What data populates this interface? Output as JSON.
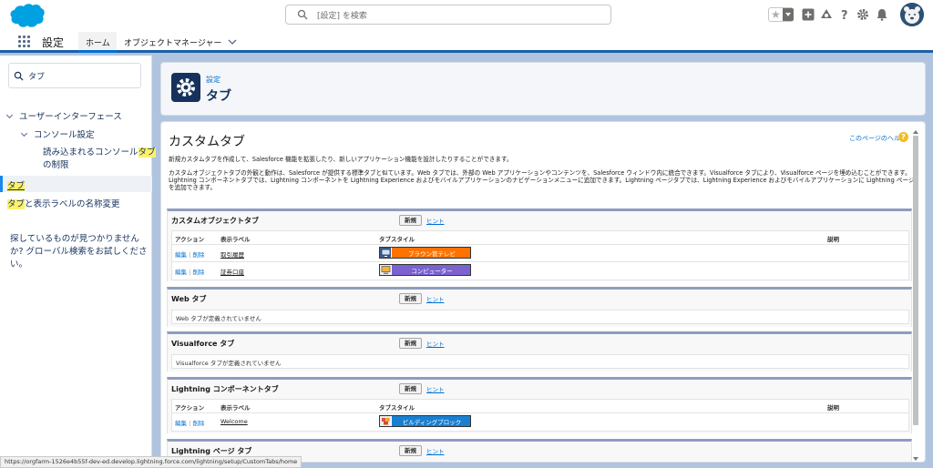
{
  "header": {
    "search_placeholder": "[設定] を検索"
  },
  "nav": {
    "app_name": "設定",
    "tabs": [
      {
        "label": "ホーム"
      },
      {
        "label": "オブジェクトマネージャー"
      }
    ]
  },
  "sidebar": {
    "quick_find_value": "タブ",
    "tree": {
      "user_interface": "ユーザーインターフェース",
      "console_settings": "コンソール設定",
      "console_tab_limit_pre": "読み込まれるコンソール",
      "console_tab_limit_hl": "タブ",
      "console_tab_limit_post": "の制限",
      "tabs_hl": "タブ",
      "rename_hl": "タブ",
      "rename_post": "と表示ラベルの名称変更"
    },
    "not_found_text": "探しているものが見つかりませんか? グローバル検索をお試しください。"
  },
  "page_header": {
    "eyebrow": "設定",
    "title": "タブ"
  },
  "main": {
    "heading": "カスタムタブ",
    "help_link": "このページのヘルプ",
    "help_icon": "?",
    "desc1": "新規カスタムタブを作成して、Salesforce 機能を拡張したり、新しいアプリケーション機能を設計したりすることができます。",
    "desc2": "カスタムオブジェクトタブの外観と動作は、Salesforce が提供する標準タブと似ています。Web タブでは、外部の Web アプリケーションやコンテンツを、Salesforce ウィンドウ内に統合できます。Visualforce タブにより、Visualforce ページを埋め込むことができます。Lightning コンポーネントタブでは、Lightning コンポーネントを Lightning Experience およびモバイルアプリケーションのナビゲーションメニューに追加できます。Lightning ページタブでは、Lightning Experience およびモバイルアプリケーションに Lightning ページを追加できます。",
    "new_button": "新規",
    "hint_link": "ヒント",
    "columns": {
      "action": "アクション",
      "label": "表示ラベル",
      "tab_style": "タブスタイル",
      "description": "説明"
    },
    "action_edit": "編集",
    "action_sep": "|",
    "action_delete": "削除",
    "sections": {
      "custom_object": {
        "title": "カスタムオブジェクトタブ",
        "rows": [
          {
            "label": "取引履歴",
            "style_name": "ブラウン管テレビ",
            "style_color": "#ff7200",
            "icon": "tv-icon"
          },
          {
            "label": "証券口座",
            "style_name": "コンピューター",
            "style_color": "#7b62cf",
            "icon": "computer-icon"
          }
        ]
      },
      "web": {
        "title": "Web タブ",
        "empty": "Web タブが定義されていません"
      },
      "visualforce": {
        "title": "Visualforce タブ",
        "empty": "Visualforce タブが定義されていません"
      },
      "lightning_component": {
        "title": "Lightning コンポーネントタブ",
        "rows": [
          {
            "label": "Welcome",
            "style_name": "ビルディングブロック",
            "style_color": "#1a7fd1",
            "icon": "blocks-icon"
          }
        ]
      },
      "lightning_page": {
        "title": "Lightning ページ タブ"
      }
    }
  },
  "status_bar": {
    "url": "https://orgfarm-1526e4b55f-dev-ed.develop.lightning.force.com/lightning/setup/CustomTabs/home"
  },
  "colors": {
    "brand_blue": "#0070d2",
    "header_bg": "#b0c4df",
    "page_icon": "#16325c"
  }
}
